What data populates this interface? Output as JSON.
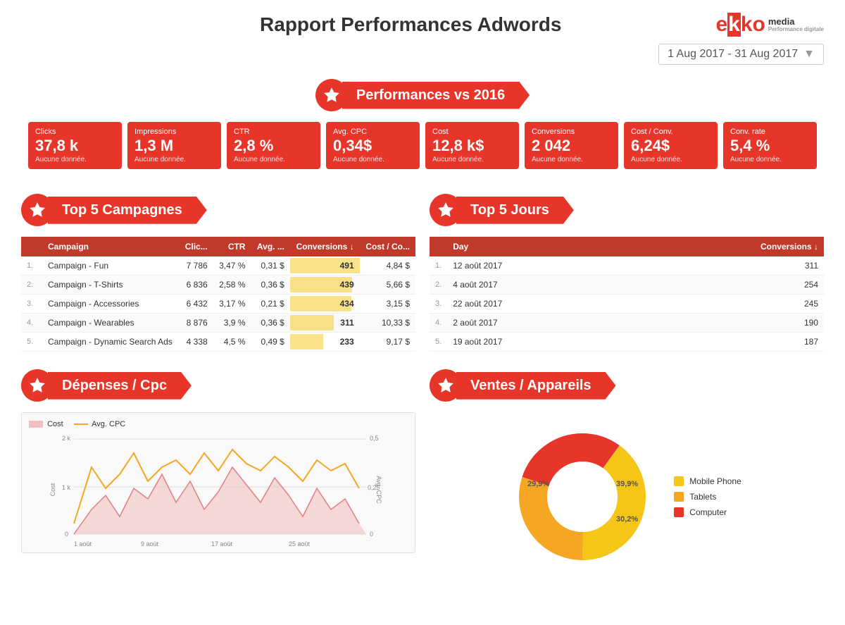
{
  "header": {
    "title": "Rapport Performances Adwords",
    "logo_ek": "ek",
    "logo_ko": "ko",
    "logo_brand": "media",
    "logo_tagline": "Performance digitale"
  },
  "date_range": {
    "label": "1 Aug 2017 - 31 Aug 2017"
  },
  "performances": {
    "section_title": "Performances vs 2016",
    "kpis": [
      {
        "label": "Clicks",
        "value": "37,8 k",
        "sub": "Aucune donnée."
      },
      {
        "label": "Impressions",
        "value": "1,3 M",
        "sub": "Aucune donnée."
      },
      {
        "label": "CTR",
        "value": "2,8 %",
        "sub": "Aucune donnée."
      },
      {
        "label": "Avg. CPC",
        "value": "0,34$",
        "sub": "Aucune donnée."
      },
      {
        "label": "Cost",
        "value": "12,8 k$",
        "sub": "Aucune donnée."
      },
      {
        "label": "Conversions",
        "value": "2 042",
        "sub": "Aucune donnée."
      },
      {
        "label": "Cost / Conv.",
        "value": "6,24$",
        "sub": "Aucune donnée."
      },
      {
        "label": "Conv. rate",
        "value": "5,4 %",
        "sub": "Aucune donnée."
      }
    ]
  },
  "top5_campagnes": {
    "section_title": "Top 5 Campagnes",
    "columns": [
      "Campaign",
      "Clic...",
      "CTR",
      "Avg. ...",
      "Conversions ↓",
      "Cost / Co..."
    ],
    "rows": [
      {
        "rank": "1.",
        "name": "Campaign - Fun",
        "clicks": "7 786",
        "ctr": "3,47 %",
        "avg_cpc": "0,31 $",
        "conversions": 491,
        "conv_max": 491,
        "cost_conv": "4,84 $"
      },
      {
        "rank": "2.",
        "name": "Campaign - T-Shirts",
        "clicks": "6 836",
        "ctr": "2,58 %",
        "avg_cpc": "0,36 $",
        "conversions": 439,
        "conv_max": 491,
        "cost_conv": "5,66 $"
      },
      {
        "rank": "3.",
        "name": "Campaign - Accessories",
        "clicks": "6 432",
        "ctr": "3,17 %",
        "avg_cpc": "0,21 $",
        "conversions": 434,
        "conv_max": 491,
        "cost_conv": "3,15 $"
      },
      {
        "rank": "4.",
        "name": "Campaign - Wearables",
        "clicks": "8 876",
        "ctr": "3,9 %",
        "avg_cpc": "0,36 $",
        "conversions": 311,
        "conv_max": 491,
        "cost_conv": "10,33 $"
      },
      {
        "rank": "5.",
        "name": "Campaign - Dynamic Search Ads",
        "clicks": "4 338",
        "ctr": "4,5 %",
        "avg_cpc": "0,49 $",
        "conversions": 233,
        "conv_max": 491,
        "cost_conv": "9,17 $"
      }
    ]
  },
  "top5_jours": {
    "section_title": "Top 5 Jours",
    "columns": [
      "Day",
      "Conversions ↓"
    ],
    "rows": [
      {
        "rank": "1.",
        "day": "12 août 2017",
        "conversions": 311
      },
      {
        "rank": "2.",
        "day": "4 août 2017",
        "conversions": 254
      },
      {
        "rank": "3.",
        "day": "22 août 2017",
        "conversions": 245
      },
      {
        "rank": "4.",
        "day": "2 août 2017",
        "conversions": 190
      },
      {
        "rank": "5.",
        "day": "19 août 2017",
        "conversions": 187
      }
    ]
  },
  "depenses_cpc": {
    "section_title": "Dépenses / Cpc",
    "legend": {
      "cost_label": "Cost",
      "avg_cpc_label": "Avg. CPC"
    },
    "x_labels": [
      "1 août",
      "9 août",
      "17 août",
      "25 août"
    ],
    "y_left": {
      "max": "2 k",
      "mid": "1 k",
      "min": "0"
    },
    "y_right": {
      "max": "0,5",
      "mid": "0,25",
      "min": "0"
    },
    "y_left_axis": "Cost",
    "y_right_axis": "Avg. CPC"
  },
  "ventes_appareils": {
    "section_title": "Ventes / Appareils",
    "segments": [
      {
        "label": "Mobile Phone",
        "value": 39.9,
        "color": "#f5c518"
      },
      {
        "label": "Tablets",
        "value": 30.2,
        "color": "#f5a623"
      },
      {
        "label": "Computer",
        "value": 29.9,
        "color": "#e8352a"
      }
    ],
    "labels_on_chart": [
      "39,9%",
      "30,2%",
      "29,9%"
    ]
  }
}
